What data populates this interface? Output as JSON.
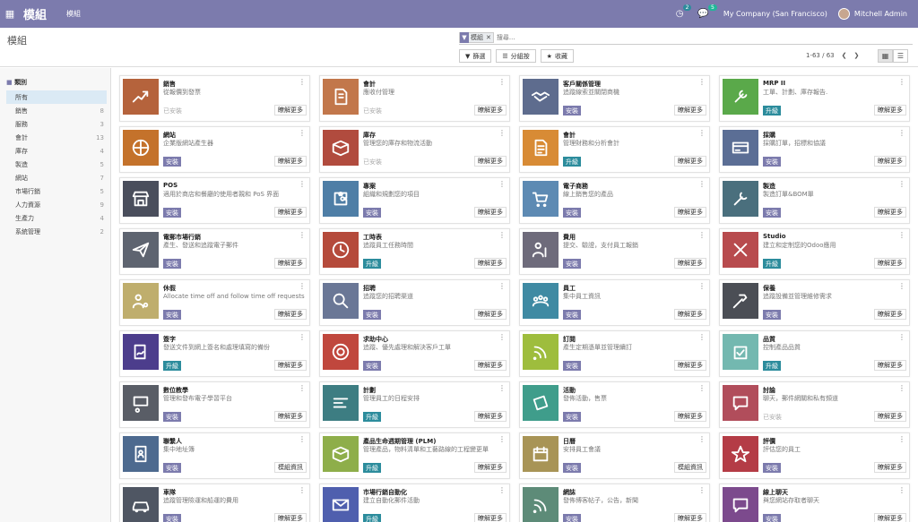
{
  "topbar": {
    "brand": "模組",
    "menu": "模組",
    "activity_count": "2",
    "message_count": "5",
    "company": "My Company (San Francisco)",
    "user": "Mitchell Admin"
  },
  "controlpanel": {
    "title": "模組",
    "facet_label": "模組",
    "search_placeholder": "搜尋...",
    "filters": "篩選",
    "groupby": "分組按",
    "favorites": "收藏",
    "pager": "1-63 / 63"
  },
  "sidebar": {
    "header": "類別",
    "items": [
      {
        "label": "所有",
        "count": ""
      },
      {
        "label": "銷售",
        "count": "8"
      },
      {
        "label": "服務",
        "count": "3"
      },
      {
        "label": "會計",
        "count": "13"
      },
      {
        "label": "庫存",
        "count": "4"
      },
      {
        "label": "製造",
        "count": "5"
      },
      {
        "label": "網站",
        "count": "7"
      },
      {
        "label": "市場行銷",
        "count": "5"
      },
      {
        "label": "人力資源",
        "count": "9"
      },
      {
        "label": "生產力",
        "count": "4"
      },
      {
        "label": "系統管理",
        "count": "2"
      }
    ]
  },
  "colors": {
    "brand": "#7c7bad",
    "upgrade": "#2c8c9c"
  },
  "modules": [
    {
      "name": "銷售",
      "desc": "從報價到發票",
      "action": "已安裝",
      "atype": "s",
      "more": "瞭解更多",
      "icon": "sales-icon",
      "color": "#b5633c"
    },
    {
      "name": "會計",
      "desc": "應收付管理",
      "action": "已安裝",
      "atype": "s",
      "more": "瞭解更多",
      "icon": "invoice-icon",
      "color": "#c2774b"
    },
    {
      "name": "客戶關係管理",
      "desc": "追蹤線索並關閉商機",
      "action": "安裝",
      "atype": "g",
      "more": "瞭解更多",
      "icon": "handshake-icon",
      "color": "#5e6c8e"
    },
    {
      "name": "MRP II",
      "desc": "工單、計劃、庫存報告.",
      "action": "升級",
      "atype": "t",
      "more": "瞭解更多",
      "icon": "wrench-icon",
      "color": "#5aa94a"
    },
    {
      "name": "網站",
      "desc": "企業版網站產生器",
      "action": "安裝",
      "atype": "g",
      "more": "瞭解更多",
      "icon": "globe-icon",
      "color": "#c4722b"
    },
    {
      "name": "庫存",
      "desc": "管理您的庫存和物流活動",
      "action": "已安裝",
      "atype": "s",
      "more": "瞭解更多",
      "icon": "box-icon",
      "color": "#b14b3e"
    },
    {
      "name": "會計",
      "desc": "管理財務和分析會計",
      "action": "升級",
      "atype": "t",
      "more": "瞭解更多",
      "icon": "accounting-icon",
      "color": "#d88b35"
    },
    {
      "name": "採購",
      "desc": "採購訂單，招標和協議",
      "action": "安裝",
      "atype": "g",
      "more": "瞭解更多",
      "icon": "card-icon",
      "color": "#5b6e95"
    },
    {
      "name": "POS",
      "desc": "適用於商店和餐廳的使用者親和 PoS 界面",
      "action": "安裝",
      "atype": "g",
      "more": "瞭解更多",
      "icon": "store-icon",
      "color": "#4a4e5c"
    },
    {
      "name": "專案",
      "desc": "組織和規劃您的項目",
      "action": "安裝",
      "atype": "g",
      "more": "瞭解更多",
      "icon": "puzzle-icon",
      "color": "#4e7ea6"
    },
    {
      "name": "電子商務",
      "desc": "線上銷售您的產品",
      "action": "安裝",
      "atype": "g",
      "more": "瞭解更多",
      "icon": "cart-icon",
      "color": "#5d8ab3"
    },
    {
      "name": "製造",
      "desc": "製造訂單&BOM單",
      "action": "安裝",
      "atype": "g",
      "more": "瞭解更多",
      "icon": "tools-icon",
      "color": "#4a6f7d"
    },
    {
      "name": "電郵市場行銷",
      "desc": "產生、發送和追蹤電子郵件",
      "action": "安裝",
      "atype": "g",
      "more": "瞭解更多",
      "icon": "paper-plane-icon",
      "color": "#5e6470"
    },
    {
      "name": "工時表",
      "desc": "追蹤員工任務時間",
      "action": "升級",
      "atype": "t",
      "more": "瞭解更多",
      "icon": "clock-icon",
      "color": "#b54a3b"
    },
    {
      "name": "費用",
      "desc": "提交、驗證，支付員工報銷",
      "action": "安裝",
      "atype": "g",
      "more": "瞭解更多",
      "icon": "expense-icon",
      "color": "#6e6b7b"
    },
    {
      "name": "Studio",
      "desc": "建立和定制您的Odoo應用",
      "action": "升級",
      "atype": "t",
      "more": "瞭解更多",
      "icon": "studio-icon",
      "color": "#b84b4e"
    },
    {
      "name": "休假",
      "desc": "Allocate time off and follow time off requests",
      "action": "安裝",
      "atype": "g",
      "more": "瞭解更多",
      "icon": "users-gear-icon",
      "color": "#bfae6d"
    },
    {
      "name": "招聘",
      "desc": "追蹤您的招聘渠道",
      "action": "安裝",
      "atype": "g",
      "more": "瞭解更多",
      "icon": "magnifier-icon",
      "color": "#6a7796"
    },
    {
      "name": "員工",
      "desc": "集中員工資訊",
      "action": "安裝",
      "atype": "g",
      "more": "瞭解更多",
      "icon": "team-icon",
      "color": "#3f8aa3"
    },
    {
      "name": "保養",
      "desc": "追蹤設備並管理維修需求",
      "action": "安裝",
      "atype": "g",
      "more": "瞭解更多",
      "icon": "hammer-icon",
      "color": "#4b4e55"
    },
    {
      "name": "簽字",
      "desc": "發送文件到網上簽名和處理填寫的備份",
      "action": "升級",
      "atype": "t",
      "more": "瞭解更多",
      "icon": "signature-icon",
      "color": "#4c3d8c"
    },
    {
      "name": "求助中心",
      "desc": "追蹤、優先處理和解決客戶工單",
      "action": "安裝",
      "atype": "g",
      "more": "瞭解更多",
      "icon": "lifebuoy-icon",
      "color": "#c0473d"
    },
    {
      "name": "訂閱",
      "desc": "產生定期憑單並管理續訂",
      "action": "安裝",
      "atype": "g",
      "more": "瞭解更多",
      "icon": "rss-icon",
      "color": "#9ebd3d"
    },
    {
      "name": "品質",
      "desc": "控制產品品質",
      "action": "升級",
      "atype": "t",
      "more": "瞭解更多",
      "icon": "quality-icon",
      "color": "#73b8b0"
    },
    {
      "name": "數位教學",
      "desc": "管理和發布電子學習平台",
      "action": "安裝",
      "atype": "g",
      "more": "瞭解更多",
      "icon": "teacher-icon",
      "color": "#595d66"
    },
    {
      "name": "計劃",
      "desc": "管理員工的日程安排",
      "action": "升級",
      "atype": "t",
      "more": "瞭解更多",
      "icon": "planning-icon",
      "color": "#3d7d82"
    },
    {
      "name": "活動",
      "desc": "發佈活動，售票",
      "action": "安裝",
      "atype": "g",
      "more": "瞭解更多",
      "icon": "ticket-icon",
      "color": "#3f9d8b"
    },
    {
      "name": "討論",
      "desc": "聊天，郵件網關和私有頻道",
      "action": "已安裝",
      "atype": "s",
      "more": "瞭解更多",
      "icon": "chat-icon",
      "color": "#b14d5b"
    },
    {
      "name": "聯繫人",
      "desc": "集中地址簿",
      "action": "安裝",
      "atype": "g",
      "more": "模組資訊",
      "icon": "contact-icon",
      "color": "#4d6a8f"
    },
    {
      "name": "產品生命週期管理 (PLM)",
      "desc": "管理產品，物料清單和工藝路線的工程變更單",
      "action": "升級",
      "atype": "t",
      "more": "瞭解更多",
      "icon": "plm-icon",
      "color": "#8eae4a"
    },
    {
      "name": "日曆",
      "desc": "安排員工會議",
      "action": "安裝",
      "atype": "g",
      "more": "模組資訊",
      "icon": "calendar-icon",
      "color": "#a89456"
    },
    {
      "name": "評價",
      "desc": "評估您的員工",
      "action": "安裝",
      "atype": "g",
      "more": "瞭解更多",
      "icon": "star-icon",
      "color": "#b43c46"
    },
    {
      "name": "車隊",
      "desc": "追蹤管理險運和船運的費用",
      "action": "安裝",
      "atype": "g",
      "more": "瞭解更多",
      "icon": "car-icon",
      "color": "#4f5663"
    },
    {
      "name": "市場行銷自動化",
      "desc": "建立自動化郵件活動",
      "action": "升級",
      "atype": "t",
      "more": "瞭解更多",
      "icon": "mail-gear-icon",
      "color": "#4f5fae"
    },
    {
      "name": "網誌",
      "desc": "發佈博客帖子，公告，新聞",
      "action": "安裝",
      "atype": "g",
      "more": "瞭解更多",
      "icon": "blog-icon",
      "color": "#5d8b78"
    },
    {
      "name": "線上聊天",
      "desc": "與您網站存取者聊天",
      "action": "安裝",
      "atype": "g",
      "more": "瞭解更多",
      "icon": "livechat-icon",
      "color": "#7c4a8d"
    }
  ]
}
